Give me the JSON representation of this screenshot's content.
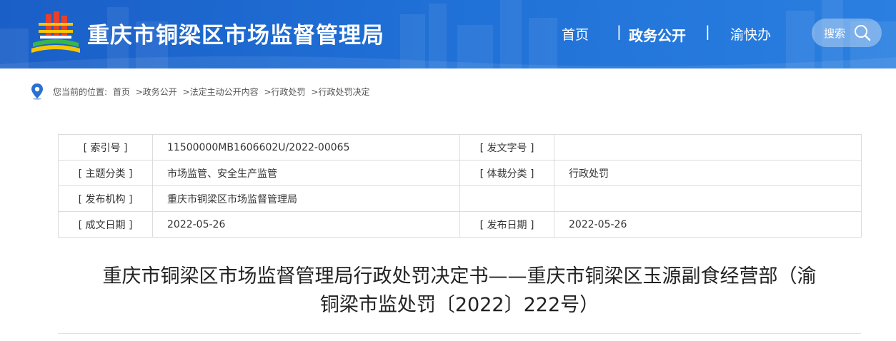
{
  "header": {
    "site_title": "重庆市铜梁区市场监督管理局",
    "nav": {
      "home": "首页",
      "separator": "|",
      "gov_affairs": "政务公开",
      "yu_kuai_ban": "渝快办"
    },
    "search_label": "搜索",
    "colors": {
      "header_bg": "#1f6fd6",
      "text": "#ffffff"
    }
  },
  "breadcrumb": {
    "prefix": "您当前的位置:",
    "items": [
      "首页",
      ">政务公开",
      ">法定主动公开内容",
      ">行政处罚",
      ">行政处罚决定"
    ]
  },
  "meta": {
    "index_no_label": "[ 索引号 ]",
    "index_no": "11500000MB1606602U/2022-00065",
    "doc_no_label": "[ 发文字号 ]",
    "doc_no": "",
    "topic_label": "[ 主题分类 ]",
    "topic": "市场监管、安全生产监管",
    "genre_label": "[ 体裁分类 ]",
    "genre": "行政处罚",
    "publisher_label": "[ 发布机构 ]",
    "publisher": "重庆市铜梁区市场监督管理局",
    "created_label": "[ 成文日期 ]",
    "created": "2022-05-26",
    "published_label": "[ 发布日期 ]",
    "published": "2022-05-26"
  },
  "document": {
    "title_line1": "重庆市铜梁区市场监督管理局行政处罚决定书——重庆市铜梁区玉源副食经营部（渝",
    "title_line2": "铜梁市监处罚〔2022〕222号）"
  }
}
